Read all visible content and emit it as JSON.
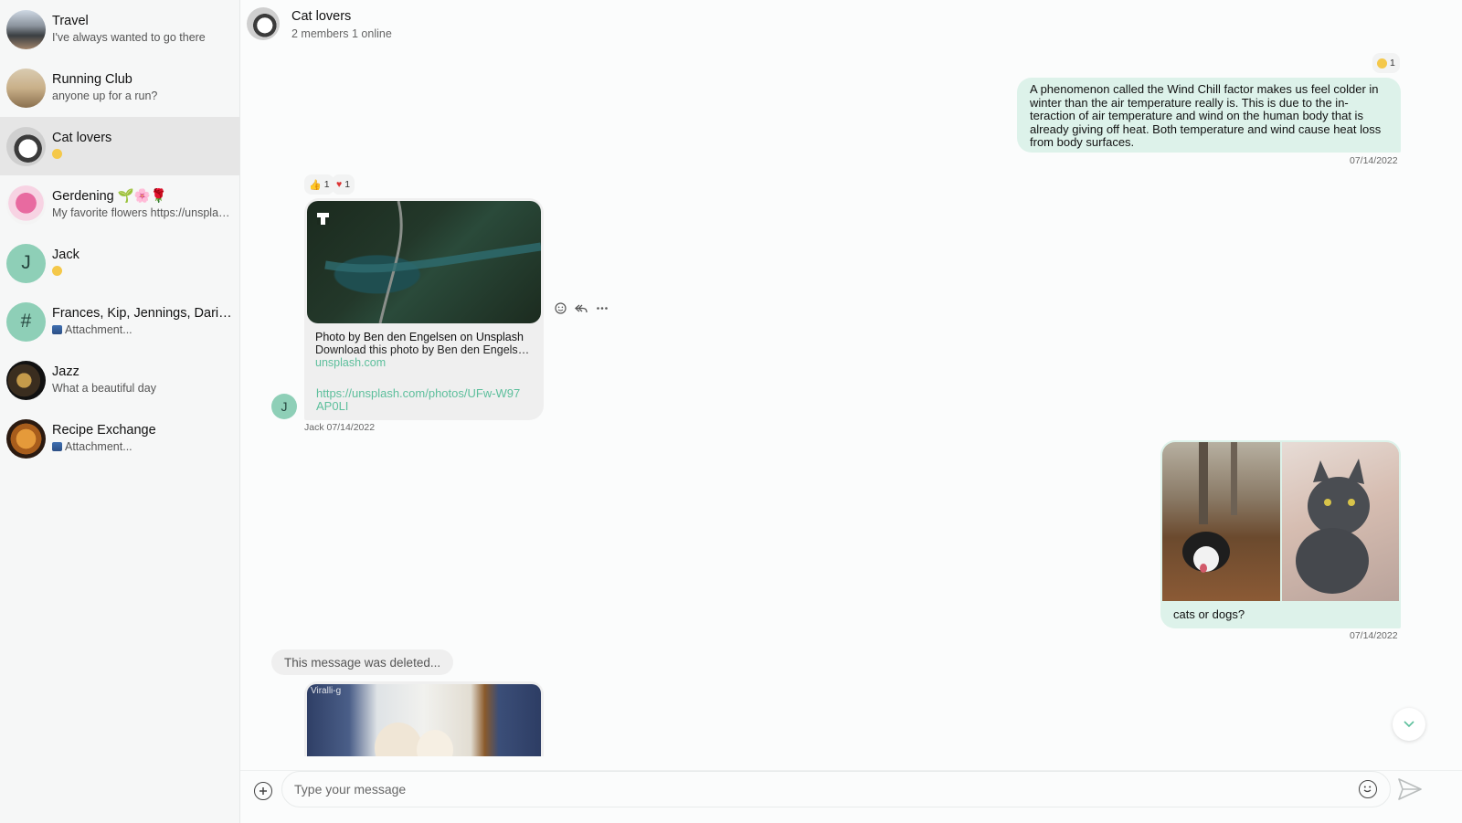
{
  "sidebar": {
    "channels": [
      {
        "name": "Travel",
        "preview": "I've always wanted to go there"
      },
      {
        "name": "Running Club",
        "preview": "anyone up for a run?"
      },
      {
        "name": "Cat lovers",
        "preview": ""
      },
      {
        "name": "Gerdening 🌱🌸🌹",
        "preview": "My favorite flowers https://unsplash.com/photos/..."
      },
      {
        "name": "Jack",
        "preview": "",
        "avatar_letter": "J"
      },
      {
        "name": "Frances, Kip, Jennings, Darian, Kim",
        "preview": "Attachment...",
        "avatar_letter": "#"
      },
      {
        "name": "Jazz",
        "preview": "What a beautiful day"
      },
      {
        "name": "Recipe Exchange",
        "preview": "Attachment..."
      }
    ]
  },
  "header": {
    "title": "Cat lovers",
    "subtitle": "2 members 1 online"
  },
  "messages": {
    "m1": {
      "reaction": "1",
      "text": "A phenomenon called the Wind Chill factor makes us feel colder in winter than the air temperature really is. This is due to the in-teraction of air temperature and wind on the human body that is already giving off heat. Both temperature and wind cause heat loss from body surfaces.",
      "date": "07/14/2022"
    },
    "m2": {
      "reaction_like": "1",
      "reaction_love": "1",
      "card_title": "Photo by Ben den Engelsen on Unsplash",
      "card_desc": "Download this photo by Ben den Engelsen on Unsplash",
      "card_source": "unsplash.com",
      "link": "https://unsplash.com/photos/UFw-W97AP0LI",
      "avatar_letter": "J",
      "meta": "Jack 07/14/2022"
    },
    "m3": {
      "text": "cats or dogs?",
      "date": "07/14/2022"
    },
    "m4": {
      "deleted_text": "This message was deleted...",
      "image_caption": "Viralli-g"
    }
  },
  "composer": {
    "placeholder": "Type your message"
  },
  "colors": {
    "accent": "#5dbf9c",
    "bubble_out": "#ddf2ea",
    "bubble_in": "#efefef",
    "sidebar_active": "#e6e6e6"
  }
}
